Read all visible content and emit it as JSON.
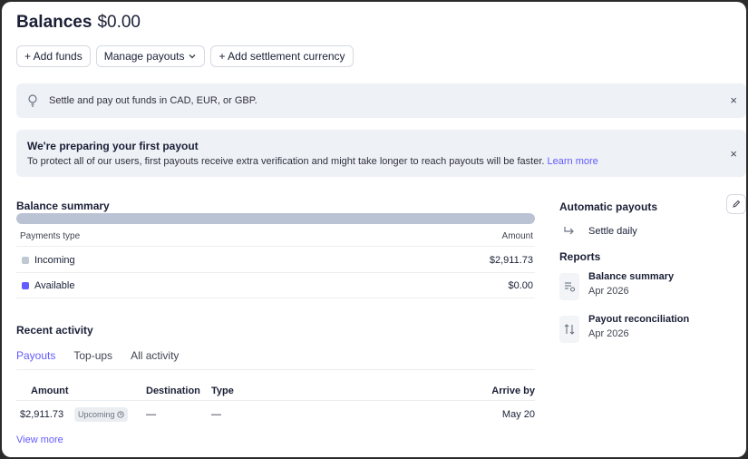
{
  "header": {
    "title": "Balances",
    "amount": "$0.00"
  },
  "toolbar": {
    "add_funds": "+ Add funds",
    "manage_payouts": "Manage payouts",
    "add_settlement_currency": "+ Add settlement currency"
  },
  "banners": {
    "settle": {
      "text": "Settle and pay out funds in CAD, EUR, or GBP.",
      "icon": "lightbulb-icon",
      "close": "×"
    },
    "payout": {
      "title": "We're preparing your first payout",
      "text": "To protect all of our users, first payouts receive extra verification and might take longer to reach payouts will be faster.",
      "link": "Learn more",
      "close": "×"
    }
  },
  "balance_summary": {
    "title": "Balance summary",
    "columns": {
      "type": "Payments type",
      "amount": "Amount"
    },
    "rows": [
      {
        "label": "Incoming",
        "value": "$2,911.73",
        "color": "#c0c8d2"
      },
      {
        "label": "Available",
        "value": "$0.00",
        "color": "#635bff"
      }
    ]
  },
  "recent_activity": {
    "title": "Recent activity",
    "tabs": [
      "Payouts",
      "Top-ups",
      "All activity"
    ],
    "active_tab": "Payouts",
    "columns": {
      "amount": "Amount",
      "destination": "Destination",
      "type": "Type",
      "arrive_by": "Arrive by"
    },
    "rows": [
      {
        "amount": "$2,911.73",
        "status": "Upcoming",
        "destination": "—",
        "type": "—",
        "arrive_by": "May 20"
      }
    ],
    "view_more": "View more"
  },
  "automatic_payouts": {
    "title": "Automatic payouts",
    "schedule": "Settle daily"
  },
  "reports": {
    "title": "Reports",
    "items": [
      {
        "name": "Balance summary",
        "date": "Apr 2026",
        "icon": "report-list-icon"
      },
      {
        "name": "Payout reconciliation",
        "date": "Apr 2026",
        "icon": "arrows-up-down-icon"
      }
    ]
  },
  "colors": {
    "accent": "#635bff",
    "banner_bg": "#eef1f6",
    "bar": "#b9c3d4"
  }
}
